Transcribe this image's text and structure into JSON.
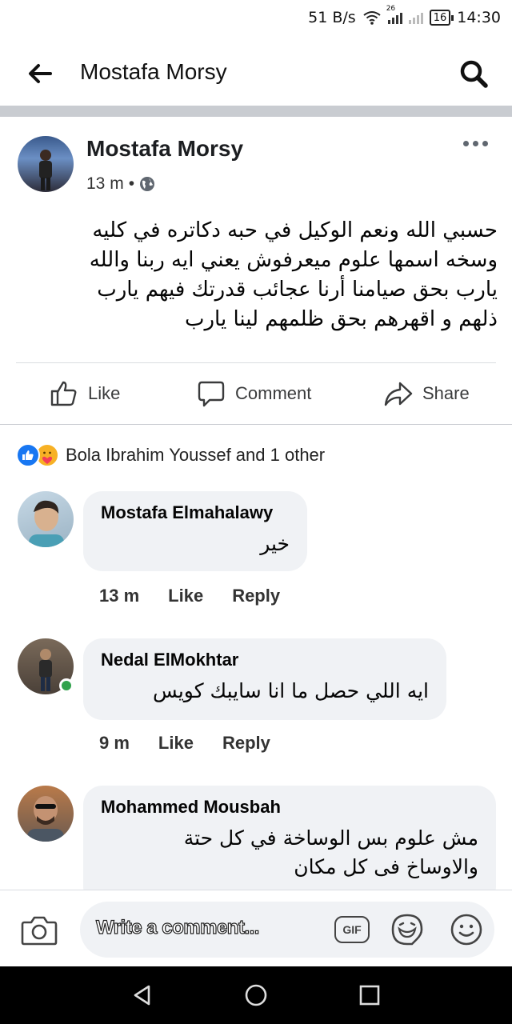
{
  "status_bar": {
    "speed": "51 B/s",
    "network_tag": "26",
    "battery": "16",
    "time": "14:30"
  },
  "app_bar": {
    "title": "Mostafa Morsy"
  },
  "post": {
    "author": "Mostafa Morsy",
    "time": "13 m",
    "separator": "•",
    "lines": [
      "حسبي الله ونعم الوكيل في حبه دكاتره في كليه",
      "وسخه اسمها علوم  ميعرفوش يعني ايه ربنا والله",
      "يارب بحق صيامنا أرنا عجائب قدرتك فيهم  يارب",
      "ذلهم و اقهرهم بحق ظلمهم لينا يارب"
    ]
  },
  "actions": {
    "like": "Like",
    "comment": "Comment",
    "share": "Share"
  },
  "reactions": {
    "summary": "Bola Ibrahim Youssef and 1 other"
  },
  "comments": [
    {
      "name": "Mostafa Elmahalawy",
      "lines": [
        "خير"
      ],
      "time": "13 m",
      "like": "Like",
      "reply": "Reply"
    },
    {
      "name": "Nedal ElMokhtar",
      "lines": [
        "ايه اللي حصل ما انا سايبك كويس"
      ],
      "time": "9 m",
      "like": "Like",
      "reply": "Reply"
    },
    {
      "name": "Mohammed Mousbah",
      "lines": [
        "مش علوم بس الوساخة في كل حتة",
        "والاوساخ فى كل مكان"
      ]
    }
  ],
  "composer": {
    "placeholder": "Write a comment...",
    "gif_label": "GIF"
  },
  "colors": {
    "brand_blue": "#1877f2",
    "divider": "#c9ccd1",
    "bubble": "#f0f2f5",
    "online": "#31a24c"
  }
}
